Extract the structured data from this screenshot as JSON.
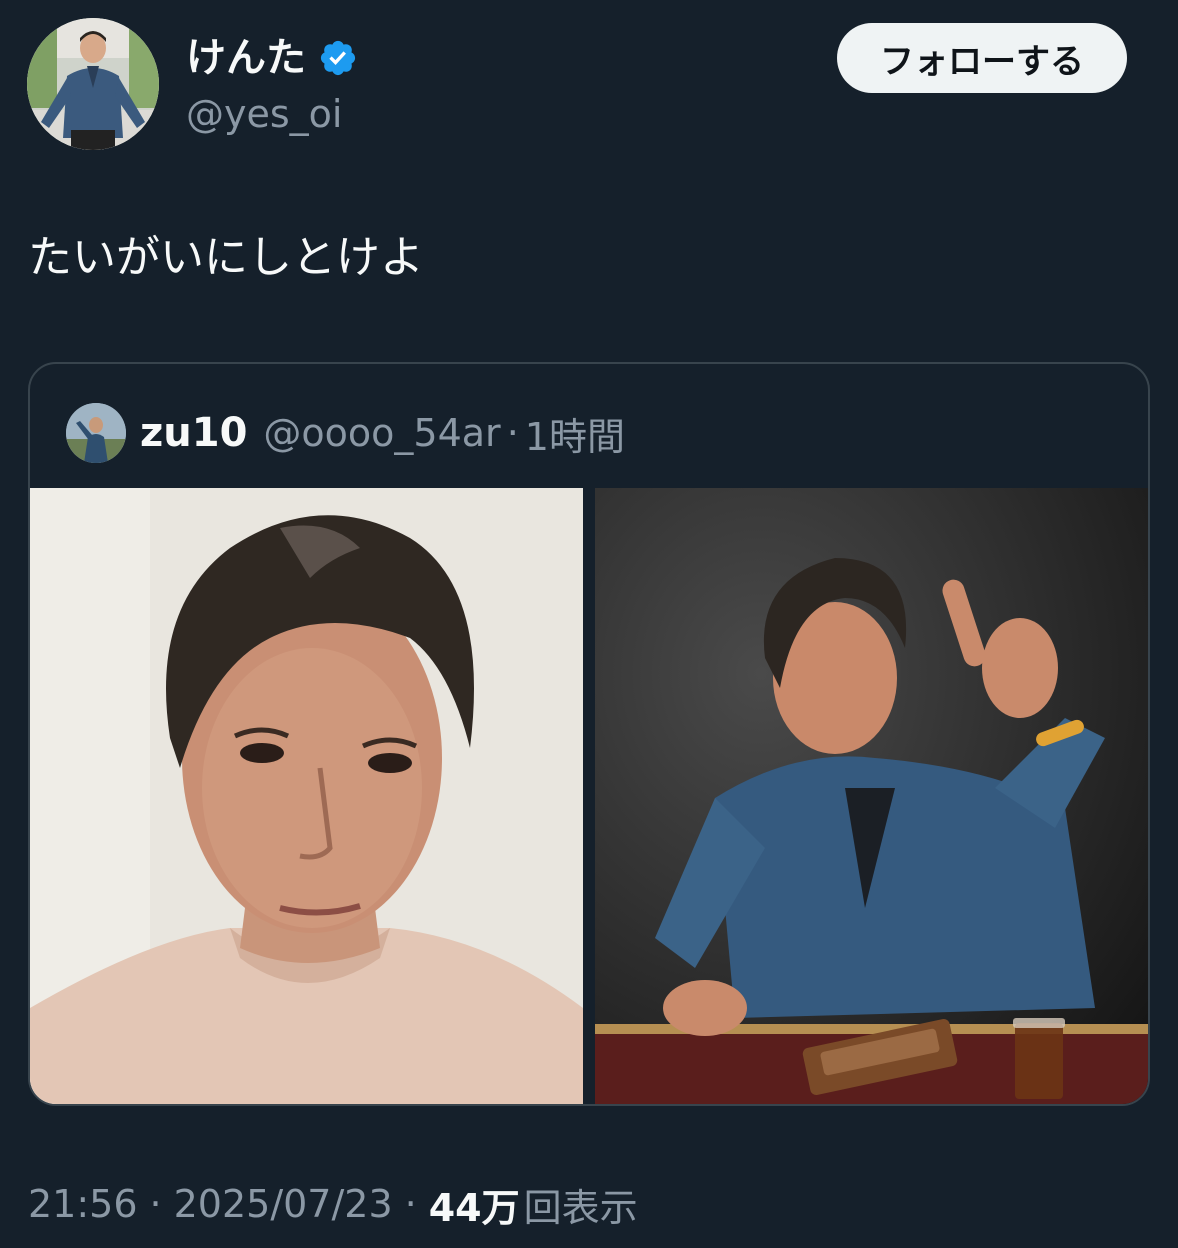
{
  "author": {
    "display_name": "けんた",
    "handle": "@yes_oi",
    "verified": true,
    "verified_color": "#1d9bf0"
  },
  "follow_button": {
    "label": "フォローする"
  },
  "tweet": {
    "text": "たいがいにしとけよ"
  },
  "quoted": {
    "display_name": "zu10",
    "handle": "@oooo_54ar",
    "separator": "·",
    "time": "1時間"
  },
  "meta": {
    "time": "21:56",
    "date": "2025/07/23",
    "separator": "·",
    "views_count": "44万",
    "views_label": "回表示"
  },
  "theme": {
    "background": "#15202b",
    "text_primary": "#f7f9f9",
    "text_secondary": "#8b98a5",
    "border": "#38444d"
  }
}
